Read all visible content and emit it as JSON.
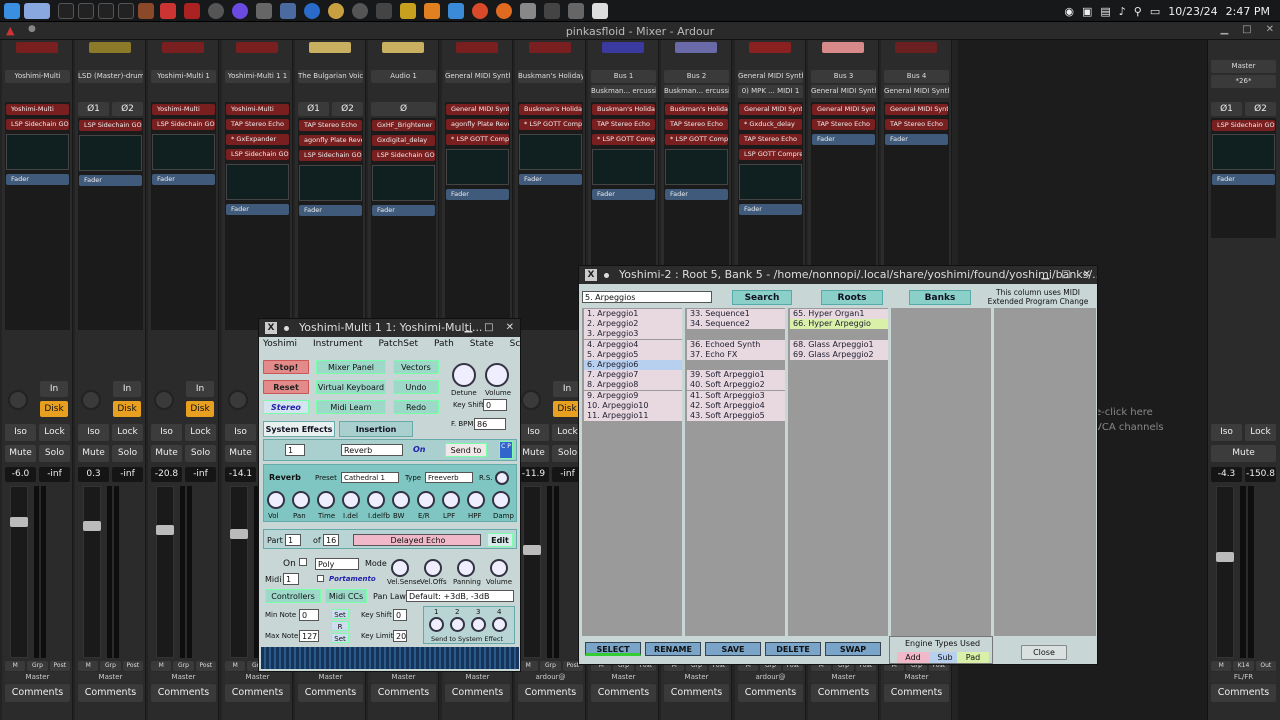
{
  "taskbar": {
    "date": "10/23/24",
    "time": "2:47 PM"
  },
  "window": {
    "title": "pinkasfloid - Mixer - Ardour"
  },
  "strips": [
    {
      "name": "Yoshimi-Multi",
      "color": "#7a1f1f",
      "phase": [],
      "plugins": [
        "Yoshimi-Multi",
        "LSP Sidechain GO"
      ],
      "gain": "-6.0",
      "peak": "-inf",
      "disk": true
    },
    {
      "name": "LSD (Master)-drums",
      "color": "#8a7a2a",
      "phase": [
        "Ø1",
        "Ø2"
      ],
      "plugins": [
        "LSP Sidechain GO"
      ],
      "gain": "0.3",
      "peak": "-inf",
      "disk": true
    },
    {
      "name": "Yoshimi-Multi 1",
      "color": "#7a1f1f",
      "phase": [],
      "plugins": [
        "Yoshimi-Multi",
        "LSP Sidechain GO"
      ],
      "gain": "-20.8",
      "peak": "-inf",
      "disk": true
    },
    {
      "name": "Yoshimi-Multi 1 1",
      "color": "#7a1f1f",
      "phase": [],
      "plugins": [
        "Yoshimi-Multi",
        "TAP Stereo Echo",
        "* GxExpander",
        "LSP Sidechain GO"
      ],
      "gain": "-14.1",
      "peak": "",
      "disk": false
    },
    {
      "name": "The Bulgarian Voice...",
      "color": "#c8b060",
      "phase": [
        "Ø1",
        "Ø2"
      ],
      "plugins": [
        "TAP Stereo Echo",
        "agonfly Plate Reverb (VST",
        "LSP Sidechain GO"
      ],
      "gain": "",
      "peak": "",
      "disk": false
    },
    {
      "name": "Audio 1",
      "color": "#c8b060",
      "phase": [
        "Ø"
      ],
      "plugins": [
        "GxHF_Brightener",
        "Gxdigital_delay",
        "LSP Sidechain GO"
      ],
      "gain": "",
      "peak": "",
      "disk": false
    },
    {
      "name": "General MIDI Synth",
      "color": "#7a1f1f",
      "phase": [],
      "plugins": [
        "General MIDI Synt",
        "agonfly Plate Reverb (VST",
        "* LSP GOTT Comp"
      ],
      "gain": "",
      "peak": "",
      "disk": false
    },
    {
      "name": "Buskman's Holiday ...",
      "color": "#7a1f1f",
      "phase": [],
      "plugins": [
        "Buskman's Holida",
        "* LSP GOTT Comp"
      ],
      "gain": "-11.9",
      "peak": "-inf",
      "disk": true
    },
    {
      "name": "Bus 1",
      "sub": "Buskman... ercussion",
      "color": "#3a3aa0",
      "phase": [],
      "plugins": [
        "Buskman's Holida",
        "TAP Stereo Echo",
        "* LSP GOTT Comp"
      ],
      "gain": "",
      "peak": "",
      "disk": false
    },
    {
      "name": "Bus 2",
      "sub": "Buskman... ercussion",
      "color": "#6a6aa8",
      "phase": [],
      "plugins": [
        "Buskman's Holida",
        "TAP Stereo Echo",
        "* LSP GOTT Comp"
      ],
      "gain": "",
      "peak": "",
      "disk": false
    },
    {
      "name": "General MIDI Synth 1",
      "sub": "0) MPK ... MIDI 1",
      "color": "#8a2020",
      "phase": [],
      "plugins": [
        "General MIDI Synt",
        "* Gxduck_delay",
        "TAP Stereo Echo",
        "LSP GOTT Compre"
      ],
      "gain": "",
      "peak": "",
      "disk": false
    },
    {
      "name": "Bus 3",
      "sub": "General MIDI Synth 1",
      "color": "#d88a8a",
      "phase": [],
      "plugins": [
        "General MIDI Synt",
        "TAP Stereo Echo"
      ],
      "gain": "",
      "peak": "",
      "disk": false
    },
    {
      "name": "Bus 4",
      "sub": "General MIDI Synth 1",
      "color": "#6a2020",
      "phase": [],
      "plugins": [
        "General MIDI Synt",
        "TAP Stereo Echo"
      ],
      "gain": "",
      "peak": "",
      "disk": false
    }
  ],
  "labels": {
    "in": "In",
    "disk": "Disk",
    "iso": "Iso",
    "lock": "Lock",
    "mute": "Mute",
    "solo": "Solo",
    "m": "M",
    "grp": "Grp",
    "post": "Post",
    "master": "Master",
    "comments": "Comments",
    "fader": "Fader",
    "ardour": "ardour@"
  },
  "gap": {
    "hint1": "e-click here",
    "hint2": "VCA channels"
  },
  "master_strip": {
    "name": "Master",
    "sub": "*26*",
    "phase": [
      "Ø1",
      "Ø2"
    ],
    "plugin": "LSP Sidechain GO",
    "gain": "-4.3",
    "peak": "-150.8",
    "out": "Out",
    "route": "FL/FR",
    "k14": "K14"
  },
  "yoshimi": {
    "title": "Yoshimi-Multi 1 1: Yoshimi-Multi...",
    "menu": [
      "Yoshimi",
      "Instrument",
      "PatchSet",
      "Path",
      "State",
      "Scale"
    ],
    "buttons": {
      "stop": "Stop!",
      "reset": "Reset",
      "stereo": "Stereo",
      "mixer": "Mixer Panel",
      "vkeyb": "Virtual Keyboard",
      "midilearn": "Midi Learn",
      "vectors": "Vectors",
      "undo": "Undo",
      "redo": "Redo"
    },
    "knobs": {
      "detune": "Detune",
      "volume": "Volume"
    },
    "keyshift_label": "Key Shift",
    "keyshift": "0",
    "fbpm_label": "F. BPM",
    "fbpm": "86",
    "tabs": {
      "sys": "System Effects",
      "ins": "Insertion Effects"
    },
    "fx": {
      "num": "1",
      "type": "Reverb",
      "on": "On",
      "sendto": "Send to",
      "cp": "C P"
    },
    "reverb": {
      "title": "Reverb",
      "preset_label": "Preset",
      "preset": "Cathedral 1",
      "type_label": "Type",
      "type": "Freeverb",
      "rs": "R.S.",
      "knobs": [
        "Vol",
        "Pan",
        "Time",
        "I.del",
        "I.delfb",
        "BW",
        "E/R",
        "LPF",
        "HPF",
        "Damp"
      ]
    },
    "part": {
      "label": "Part",
      "num": "1",
      "of": "of",
      "total": "16",
      "name": "Delayed Echo",
      "edit": "Edit"
    },
    "on": "On",
    "mode_label": "Mode",
    "mode": "Poly",
    "midi_label": "Midi",
    "midi": "1",
    "portamento": "Portamento",
    "pknobs": [
      "Vel.Sense",
      "Vel.Offs",
      "Panning",
      "Volume"
    ],
    "controllers": "Controllers",
    "midiccs": "Midi CCs",
    "panlaw_label": "Pan Law",
    "panlaw": "Default: +3dB, -3dB",
    "minnote_label": "Min Note",
    "minnote": "0",
    "maxnote_label": "Max Note",
    "maxnote": "127",
    "set": "Set",
    "r": "R",
    "ks_label": "Key Shift",
    "ks": "0",
    "kl_label": "Key Limit",
    "kl": "20",
    "sendnums": [
      "1",
      "2",
      "3",
      "4"
    ],
    "sendsys": "Send to System Effect"
  },
  "banks": {
    "title": "Yoshimi-2 : Root 5, Bank 5 - /home/nonnopi/.local/share/yoshimi/found/yoshimi/banks/...",
    "bank": "5. Arpeggios",
    "search": "Search",
    "roots": "Roots",
    "banksbtn": "Banks",
    "note": "This column uses MIDI Extended Program Change",
    "col1": [
      "1. Arpeggio1",
      "2. Arpeggio2",
      "3. Arpeggio3",
      "4. Arpeggio4",
      "5. Arpeggio5",
      "6. Arpeggio6",
      "7. Arpeggio7",
      "8. Arpeggio8",
      "9. Arpeggio9",
      "10. Arpeggio10",
      "11. Arpeggio11"
    ],
    "col2": [
      "33. Sequence1",
      "34. Sequence2",
      "",
      "36. Echoed Synth",
      "37. Echo FX",
      "",
      "39. Soft Arpeggio1",
      "40. Soft Arpeggio2",
      "41. Soft Arpeggio3",
      "42. Soft Arpeggio4",
      "43. Soft Arpeggio5"
    ],
    "col3": [
      "65. Hyper Organ1",
      "66. Hyper Arpeggio",
      "",
      "68. Glass Arpeggio1",
      "69. Glass Arpeggio2"
    ],
    "actions": [
      "SELECT",
      "RENAME",
      "SAVE",
      "DELETE",
      "SWAP"
    ],
    "engine": {
      "title": "Engine Types Used",
      "add": "Add",
      "sub": "Sub",
      "pad": "Pad"
    },
    "close": "Close"
  }
}
